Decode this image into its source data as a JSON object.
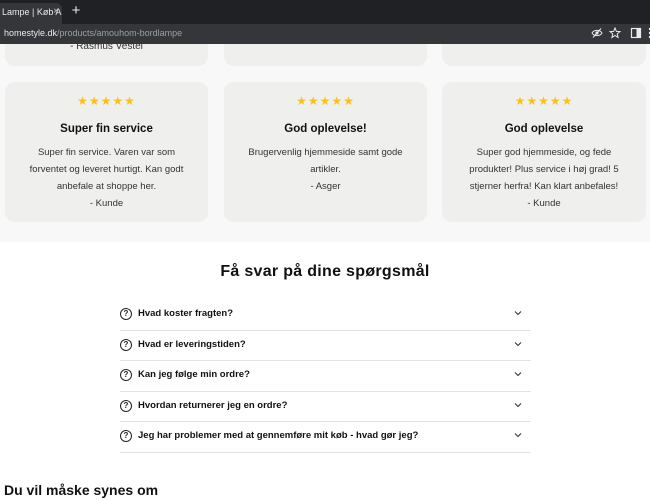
{
  "browser": {
    "tab_title": "Lampe | Køb Amouhom",
    "tab_close": "×",
    "new_tab": "+",
    "url_host": "homestyle.dk",
    "url_path": "/products/amouhom-bordlampe"
  },
  "reviews": {
    "top_partial": [
      {
        "reviewer": "- Rasmus Vestel"
      },
      {
        "reviewer": ""
      },
      {
        "reviewer": ""
      }
    ],
    "cards": [
      {
        "rating": "★★★★★",
        "title": "Super fin service",
        "body": "Super fin service. Varen var som forventet og leveret hurtigt. Kan godt anbefale at shoppe her.",
        "reviewer": "- Kunde"
      },
      {
        "rating": "★★★★★",
        "title": "God oplevelse!",
        "body": "Brugervenlig hjemmeside samt gode artikler.",
        "reviewer": "- Asger"
      },
      {
        "rating": "★★★★★",
        "title": "God oplevelse",
        "body": "Super god hjemmeside, og fede produkter! Plus service i høj grad! 5 stjerner herfra! Kan klart anbefales!",
        "reviewer": "- Kunde"
      }
    ]
  },
  "faq": {
    "title": "Få svar på dine spørgsmål",
    "icon_glyph": "?",
    "items": [
      {
        "question": "Hvad koster fragten?"
      },
      {
        "question": "Hvad er leveringstiden?"
      },
      {
        "question": "Kan jeg følge min ordre?"
      },
      {
        "question": "Hvordan returnerer jeg en ordre?"
      },
      {
        "question": "Jeg har problemer med at gennemføre mit køb - hvad gør jeg?"
      }
    ]
  },
  "related": {
    "title": "Du vil måske synes om"
  }
}
